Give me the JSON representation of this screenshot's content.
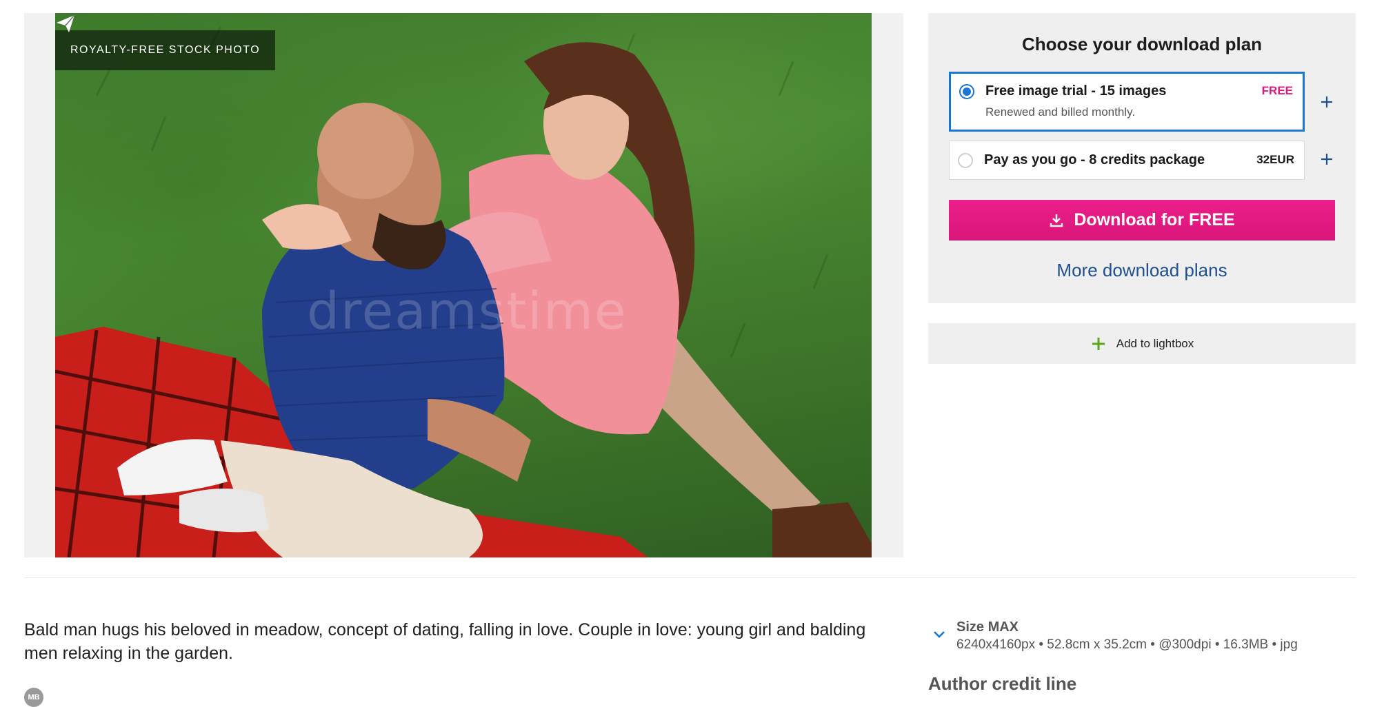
{
  "photo": {
    "badge": "ROYALTY-FREE STOCK PHOTO",
    "watermark": "dreamstime"
  },
  "plans": {
    "title": "Choose your download plan",
    "options": [
      {
        "title": "Free image trial - 15 images",
        "subtitle": "Renewed and billed monthly.",
        "price": "FREE",
        "selected": true
      },
      {
        "title": "Pay as you go - 8 credits package",
        "price": "32EUR",
        "selected": false
      }
    ],
    "download_label": "Download for FREE",
    "more_plans": "More download plans"
  },
  "lightbox": {
    "label": "Add to lightbox"
  },
  "description": "Bald man hugs his beloved in meadow, concept of dating, falling in love. Couple in love: young girl and balding men relaxing in the garden.",
  "author": {
    "initials": "MB"
  },
  "size": {
    "title": "Size MAX",
    "details": "6240x4160px • 52.8cm x 35.2cm • @300dpi • 16.3MB • jpg"
  },
  "author_credit": "Author credit line",
  "colors": {
    "accent_pink": "#e0197d",
    "selected_blue": "#1976d2",
    "link_blue": "#1e4f8f",
    "plus_green": "#5aa51e"
  },
  "icons": [
    "share-icon",
    "download-icon",
    "plus-icon",
    "chevron-down-icon"
  ]
}
